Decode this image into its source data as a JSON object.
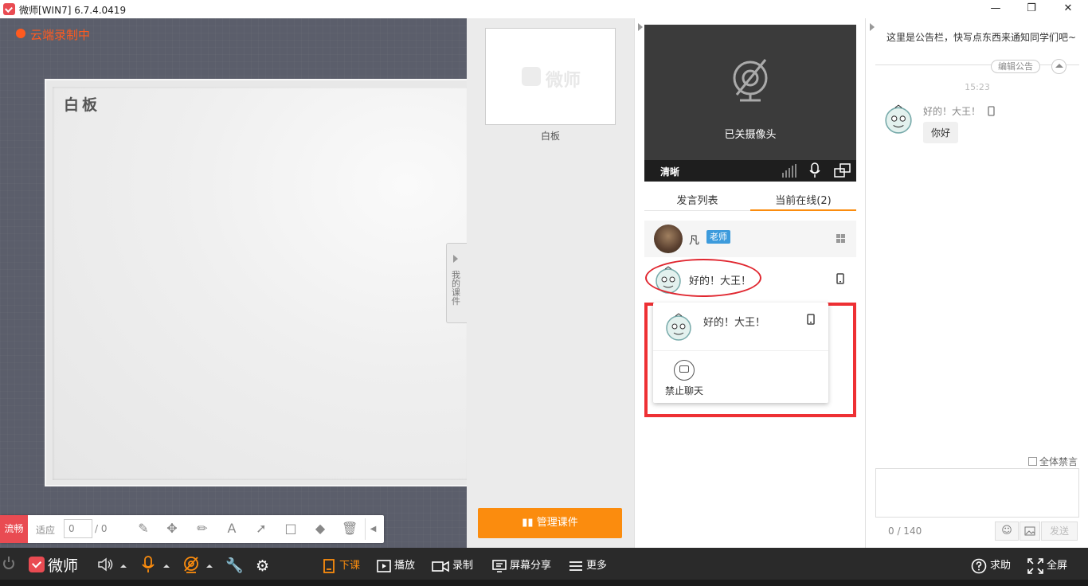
{
  "window": {
    "title": "微师[WIN7] 6.7.4.0419",
    "minimize_glyph": "—",
    "restore_glyph": "❐",
    "close_glyph": "✕"
  },
  "stage": {
    "recording_status": "云端录制中",
    "whiteboard_title": "白板",
    "my_courseware_tab": "我的课件"
  },
  "toolbox": {
    "smooth_label": "流畅",
    "fit_label": "适应",
    "page_current": "0",
    "page_total": "/ 0",
    "tools": [
      {
        "name": "pen-icon",
        "glyph": "✎"
      },
      {
        "name": "move-icon",
        "glyph": "✥"
      },
      {
        "name": "brush-icon",
        "glyph": "✏"
      },
      {
        "name": "text-icon",
        "glyph": "A"
      },
      {
        "name": "arrow-icon",
        "glyph": "➚"
      },
      {
        "name": "rectangle-icon",
        "glyph": "□"
      },
      {
        "name": "eraser-icon",
        "glyph": "◆"
      },
      {
        "name": "trash-icon",
        "glyph": "🗑"
      }
    ],
    "collapse_glyph": "◀"
  },
  "courseware": {
    "watermark": "微师",
    "thumb_label": "白板",
    "manage_button": "管理课件"
  },
  "video": {
    "camera_off_text": "已关摄像头",
    "clarity_label": "清晰"
  },
  "member_tabs": {
    "speak_list": "发言列表",
    "online_now": "当前在线(2)"
  },
  "members": {
    "teacher_name": "凡",
    "teacher_badge": "老师",
    "student_name": "好的！大王！"
  },
  "popup": {
    "student_name": "好的！大王！",
    "ban_chat_label": "禁止聊天"
  },
  "chat": {
    "notice": "这里是公告栏，快写点东西来通知同学们吧~",
    "edit_notice": "编辑公告",
    "time": "15:23",
    "message_sender": "好的！大王！",
    "message_text": "你好",
    "mute_all_label": "全体禁言",
    "char_count": "0 / 140",
    "send_label": "发送"
  },
  "bottombar": {
    "brand": "微师",
    "end_class": "下课",
    "play": "播放",
    "record": "录制",
    "screen_share": "屏幕分享",
    "more": "更多",
    "help": "求助",
    "fullscreen": "全屏"
  },
  "colors": {
    "brand": "#e94b52",
    "accent_orange": "#fb8c0e",
    "highlight_red": "#ee3034",
    "teacher_badge": "#3d9bdc"
  }
}
